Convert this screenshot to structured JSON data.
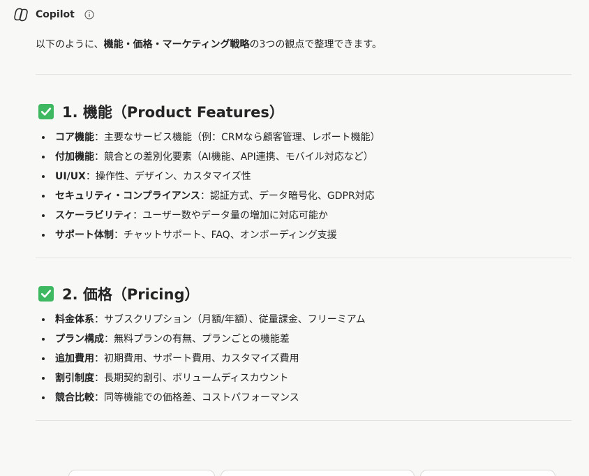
{
  "app": {
    "name": "Copilot"
  },
  "intro": {
    "prefix": "以下のように、",
    "bold": "機能・価格・マーケティング戦略",
    "suffix": "の3つの観点で整理できます。"
  },
  "sections": [
    {
      "title": "1. 機能（Product Features）",
      "items": [
        {
          "term": "コア機能",
          "text": "：主要なサービス機能（例：CRMなら顧客管理、レポート機能）"
        },
        {
          "term": "付加機能",
          "text": "：競合との差別化要素（AI機能、API連携、モバイル対応など）"
        },
        {
          "term": "UI/UX",
          "text": "：操作性、デザイン、カスタマイズ性"
        },
        {
          "term": "セキュリティ・コンプライアンス",
          "text": "：認証方式、データ暗号化、GDPR対応"
        },
        {
          "term": "スケーラビリティ",
          "text": "：ユーザー数やデータ量の増加に対応可能か"
        },
        {
          "term": "サポート体制",
          "text": "：チャットサポート、FAQ、オンボーディング支援"
        }
      ]
    },
    {
      "title": "2. 価格（Pricing）",
      "items": [
        {
          "term": "料金体系",
          "text": "：サブスクリプション（月額/年額）、従量課金、フリーミアム"
        },
        {
          "term": "プラン構成",
          "text": "：無料プランの有無、プランごとの機能差"
        },
        {
          "term": "追加費用",
          "text": "：初期費用、サポート費用、カスタマイズ費用"
        },
        {
          "term": "割引制度",
          "text": "：長期契約割引、ボリュームディスカウント"
        },
        {
          "term": "競合比較",
          "text": "：同等機能での価格差、コストパフォーマンス"
        }
      ]
    }
  ],
  "colors": {
    "check_bg": "#3fb862",
    "divider": "#e3e3e1",
    "background": "#f8f8f7"
  },
  "icons": {
    "logo": "copilot-logo-icon",
    "info": "info-icon",
    "check": "check-mark-icon"
  }
}
